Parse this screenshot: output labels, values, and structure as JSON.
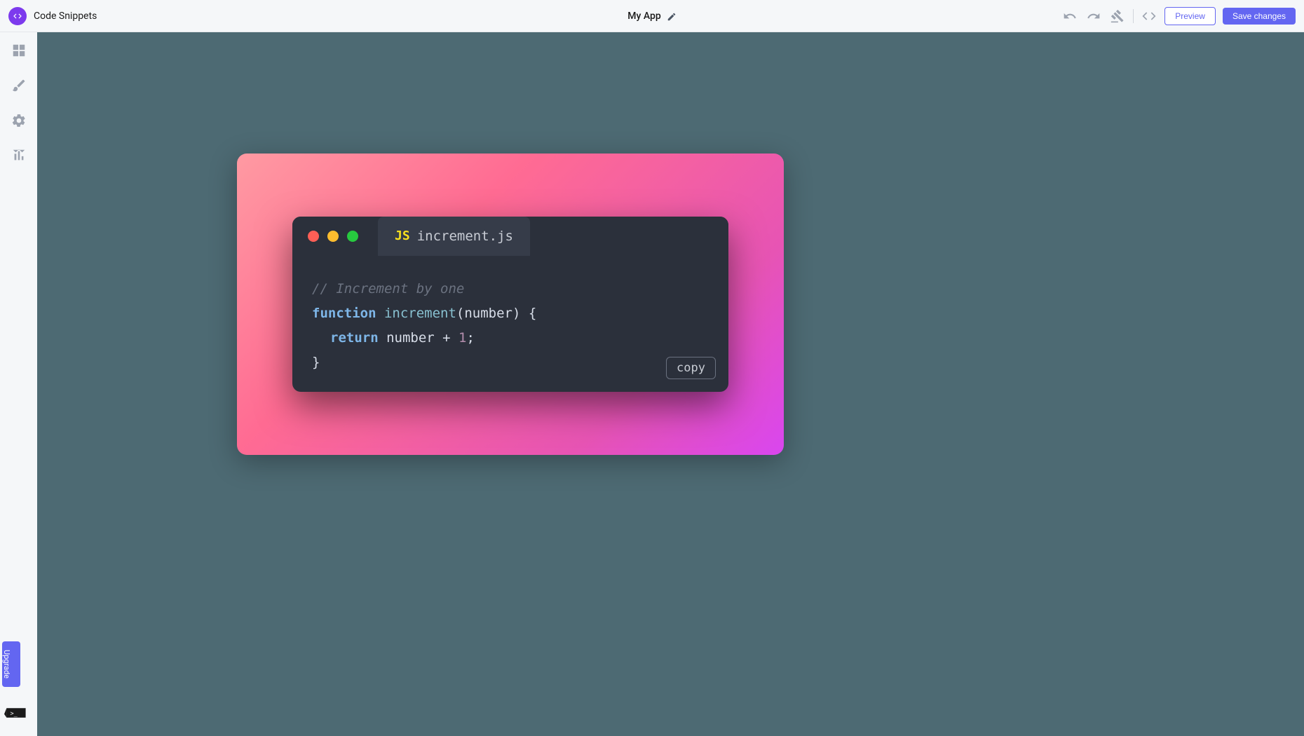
{
  "topbar": {
    "product_label": "Code Snippets",
    "app_name": "My App",
    "preview_label": "Preview",
    "save_label": "Save changes"
  },
  "sidebar": {
    "upgrade_label": "Upgrade"
  },
  "snippet": {
    "tab_lang": "JS",
    "tab_filename": "increment.js",
    "copy_label": "copy",
    "code": {
      "comment": "// Increment by one",
      "kw_function": "function",
      "fn_name": "increment",
      "params": "(number) {",
      "kw_return": "return",
      "return_expr_left": "number + ",
      "return_num": "1",
      "return_expr_right": ";",
      "close_brace": "}"
    }
  }
}
